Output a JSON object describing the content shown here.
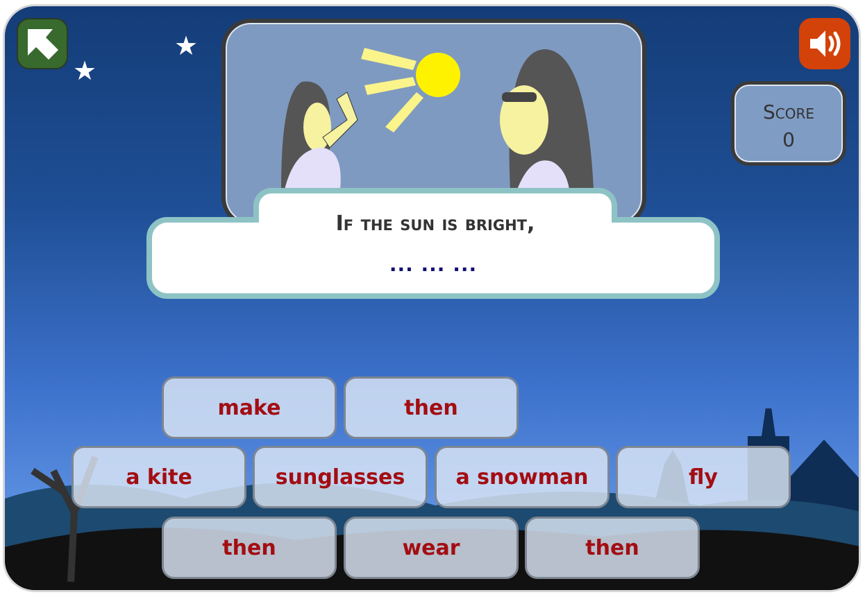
{
  "buttons": {
    "back_icon": "exit-arrow-icon",
    "sound_icon": "speaker-icon"
  },
  "score": {
    "label": "Score",
    "value": "0"
  },
  "question": {
    "prompt": "If the sun is bright,",
    "blank": "... ... ..."
  },
  "tiles": [
    {
      "label": "make"
    },
    {
      "label": "then"
    },
    {
      "label": "a kite"
    },
    {
      "label": "sunglasses"
    },
    {
      "label": "a snowman"
    },
    {
      "label": "fly"
    },
    {
      "label": "then"
    },
    {
      "label": "wear"
    },
    {
      "label": "then"
    }
  ],
  "colors": {
    "back": "#386a2e",
    "sound": "#d34208",
    "tile_text": "#a30d12",
    "frame": "#8ec3c5"
  }
}
